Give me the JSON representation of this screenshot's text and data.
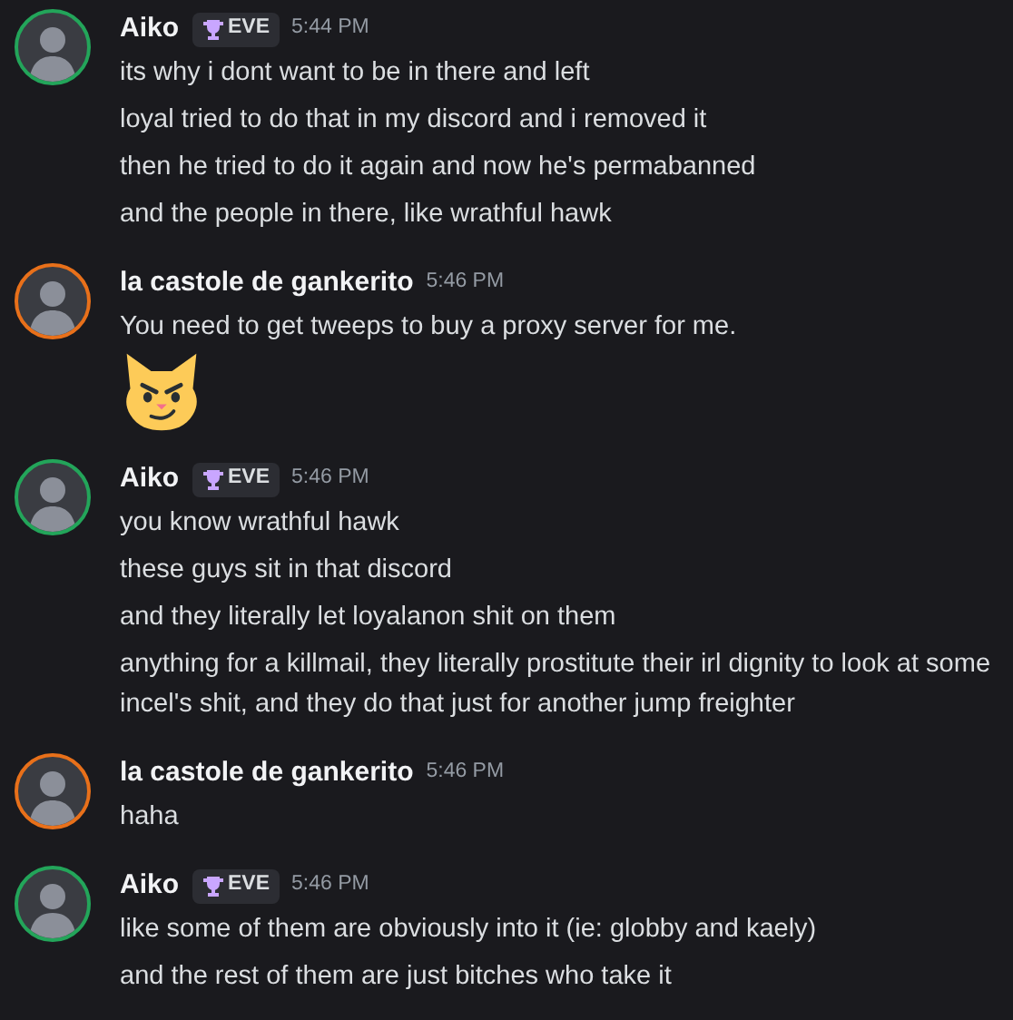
{
  "messages": [
    {
      "author": "Aiko",
      "color": "#23a55a",
      "tag": "EVE",
      "time": "5:44 PM",
      "lines": [
        {
          "kind": "text",
          "text": "its why i dont want to be in there and left"
        },
        {
          "kind": "text",
          "text": "loyal tried to do that in my discord and i removed it"
        },
        {
          "kind": "text",
          "text": "then he tried to do it again and now he's permabanned"
        },
        {
          "kind": "text",
          "text": "and the people in there, like wrathful hawk"
        }
      ]
    },
    {
      "author": "la castole de gankerito",
      "color": "#e8701a",
      "time": "5:46 PM",
      "lines": [
        {
          "kind": "text",
          "text": "You need to get tweeps to buy a proxy server for me."
        },
        {
          "kind": "emoji"
        }
      ]
    },
    {
      "author": "Aiko",
      "color": "#23a55a",
      "tag": "EVE",
      "time": "5:46 PM",
      "lines": [
        {
          "kind": "text",
          "text": "you know wrathful hawk"
        },
        {
          "kind": "text",
          "text": "these guys sit in that discord"
        },
        {
          "kind": "text",
          "text": "and they literally let loyalanon shit on them"
        },
        {
          "kind": "text",
          "text": "anything for a killmail, they literally prostitute their irl dignity to look at some incel's shit, and they do that just for another jump freighter"
        }
      ]
    },
    {
      "author": "la castole de gankerito",
      "color": "#e8701a",
      "time": "5:46 PM",
      "lines": [
        {
          "kind": "text",
          "text": "haha"
        }
      ]
    },
    {
      "author": "Aiko",
      "color": "#23a55a",
      "tag": "EVE",
      "time": "5:46 PM",
      "lines": [
        {
          "kind": "text",
          "text": "like some of them are obviously into it (ie: globby and kaely)"
        },
        {
          "kind": "text",
          "text": "and the rest of them are just bitches who take it"
        }
      ]
    }
  ]
}
